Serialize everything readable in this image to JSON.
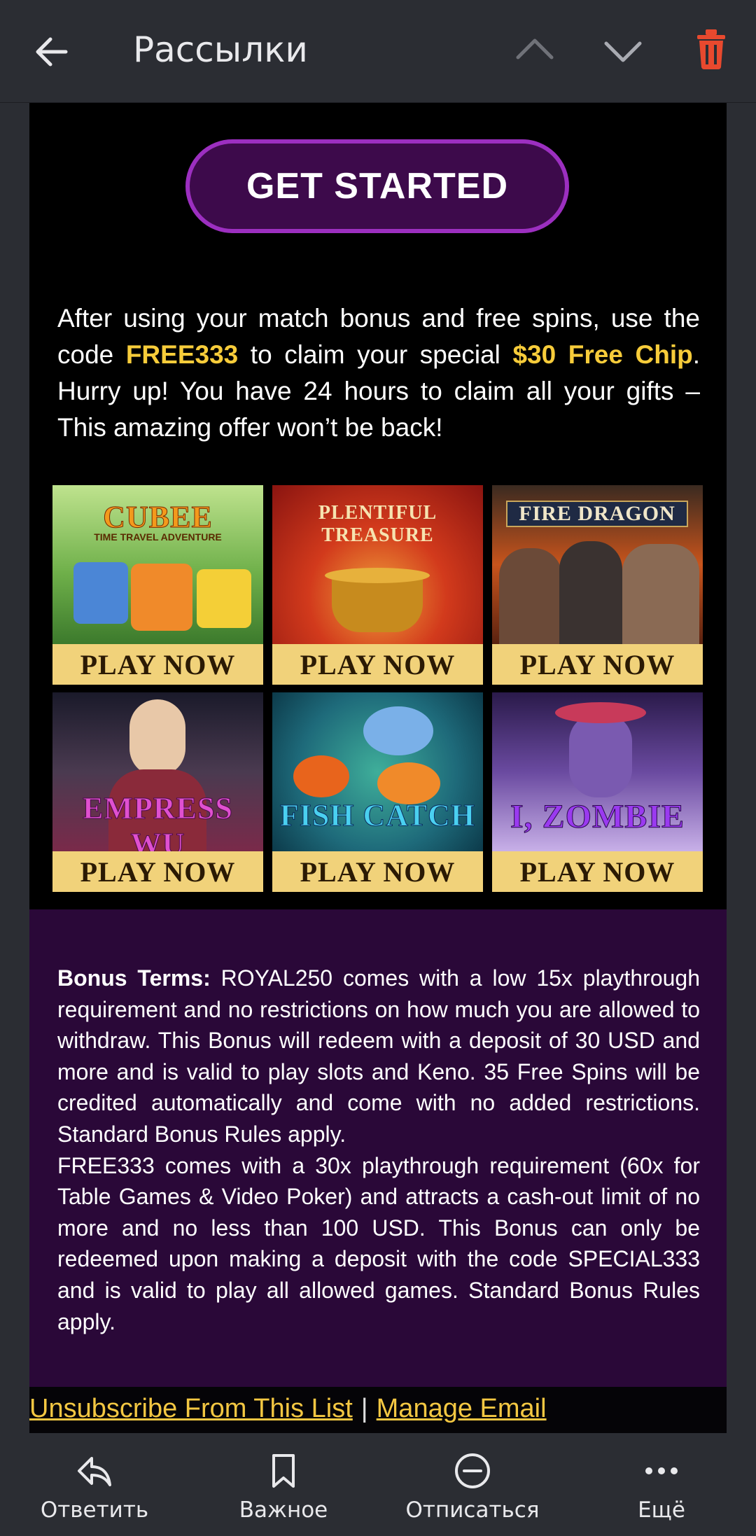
{
  "header": {
    "title": "Рассылки",
    "icons": [
      "arrow-left-icon",
      "chevron-up-icon",
      "chevron-down-icon",
      "trash-icon"
    ]
  },
  "email": {
    "cta_label": "GET STARTED",
    "intro": {
      "p1": "After using your match bonus and free spins, use the code ",
      "code": "FREE333",
      "p2": " to claim your special ",
      "chip": "$30 Free Chip",
      "p3": ". Hurry up! You have 24 hours to claim all your gifts – This amazing offer won’t be back!"
    },
    "games": [
      {
        "name": "CUBEE",
        "subtitle": "TIME TRAVEL ADVENTURE",
        "button": "PLAY NOW"
      },
      {
        "name": "PLENTIFUL TREASURE",
        "button": "PLAY NOW"
      },
      {
        "name": "FIRE DRAGON",
        "button": "PLAY NOW"
      },
      {
        "name": "EMPRESS WU",
        "button": "PLAY NOW"
      },
      {
        "name": "FISH CATCH",
        "button": "PLAY NOW"
      },
      {
        "name": "I, ZOMBIE",
        "button": "PLAY NOW"
      }
    ],
    "terms": {
      "label": "Bonus Terms:",
      "text1": " ROYAL250 comes with a low 15x playthrough requirement and no restrictions on how much you are allowed to withdraw. This Bonus will redeem with a deposit of 30 USD and more and is valid to play slots and Keno. 35 Free Spins will be credited automatically and come with no added restrictions. Standard Bonus Rules apply.",
      "text2": "FREE333 comes with a 30x playthrough requirement (60x for Table Games & Video Poker) and attracts a cash-out limit of no more and no less than 100 USD. This Bonus can only be redeemed upon making a deposit with the code SPECIAL333 and is valid to play all allowed games. Standard Bonus Rules apply."
    },
    "footer": {
      "unsubscribe": "Unsubscribe From This List",
      "separator": "|",
      "manage": "Manage Email"
    }
  },
  "bottom_bar": {
    "reply": "Ответить",
    "important": "Важное",
    "unsubscribe": "Отписаться",
    "more": "Ещё"
  },
  "colors": {
    "accent_yellow": "#f7cc3a",
    "purple": "#9c2fc0",
    "terms_bg": "#2a0838",
    "trash": "#e8492e"
  }
}
